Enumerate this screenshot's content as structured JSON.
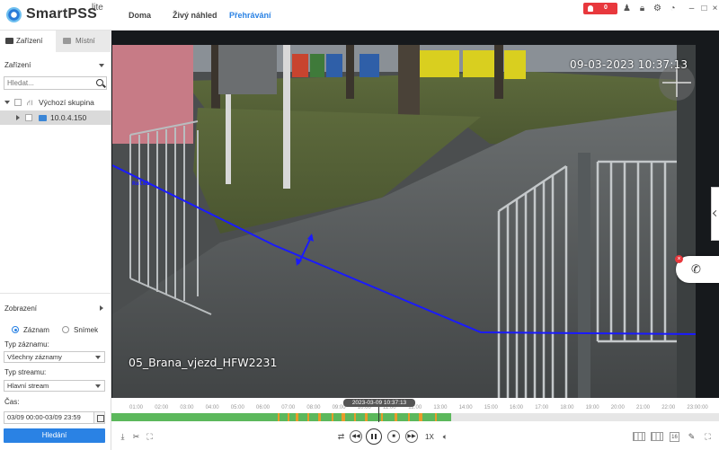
{
  "app": {
    "name": "SmartPSS",
    "edition": "lite"
  },
  "nav": [
    {
      "label": "Doma",
      "active": false
    },
    {
      "label": "Živý náhled",
      "active": false
    },
    {
      "label": "Přehrávání",
      "active": true
    }
  ],
  "header": {
    "alarm_count": "0",
    "alarm_color": "#e8383d"
  },
  "sidebar": {
    "tabs": [
      {
        "label": "Zařízení"
      },
      {
        "label": "Místní"
      }
    ],
    "device_section": "Zařízení",
    "search_placeholder": "Hledat...",
    "tree": {
      "group": "Výchozí skupina",
      "device": "10.0.4.150"
    },
    "display_section": "Zobrazení",
    "mode_options": [
      {
        "label": "Záznam",
        "selected": true
      },
      {
        "label": "Snímek",
        "selected": false
      }
    ],
    "record_type_label": "Typ záznamu:",
    "record_type_value": "Všechny záznamy",
    "stream_type_label": "Typ streamu:",
    "stream_type_value": "Hlavní stream",
    "time_label": "Čas:",
    "time_value": "03/09 00:00-03/09 23:59",
    "search_button": "Hledání"
  },
  "video": {
    "timestamp": "09-03-2023 10:37:13",
    "camera_name": "05_Brana_vjezd_HFW2231",
    "rule_label": "Rule1"
  },
  "timeline": {
    "current": "2023-03-09 10:37:13",
    "ticks": [
      "01:00",
      "02:00",
      "03:00",
      "04:00",
      "05:00",
      "06:00",
      "07:00",
      "08:00",
      "09:00",
      "10:00",
      "11:00",
      "12:00",
      "13:00",
      "14:00",
      "15:00",
      "16:00",
      "17:00",
      "18:00",
      "19:00",
      "20:00",
      "21:00",
      "22:00",
      "23:00:00"
    ],
    "speed": "1X",
    "accent": "#2a82e4",
    "record_color": "#5cb85c",
    "event_color": "#e89b2a"
  }
}
